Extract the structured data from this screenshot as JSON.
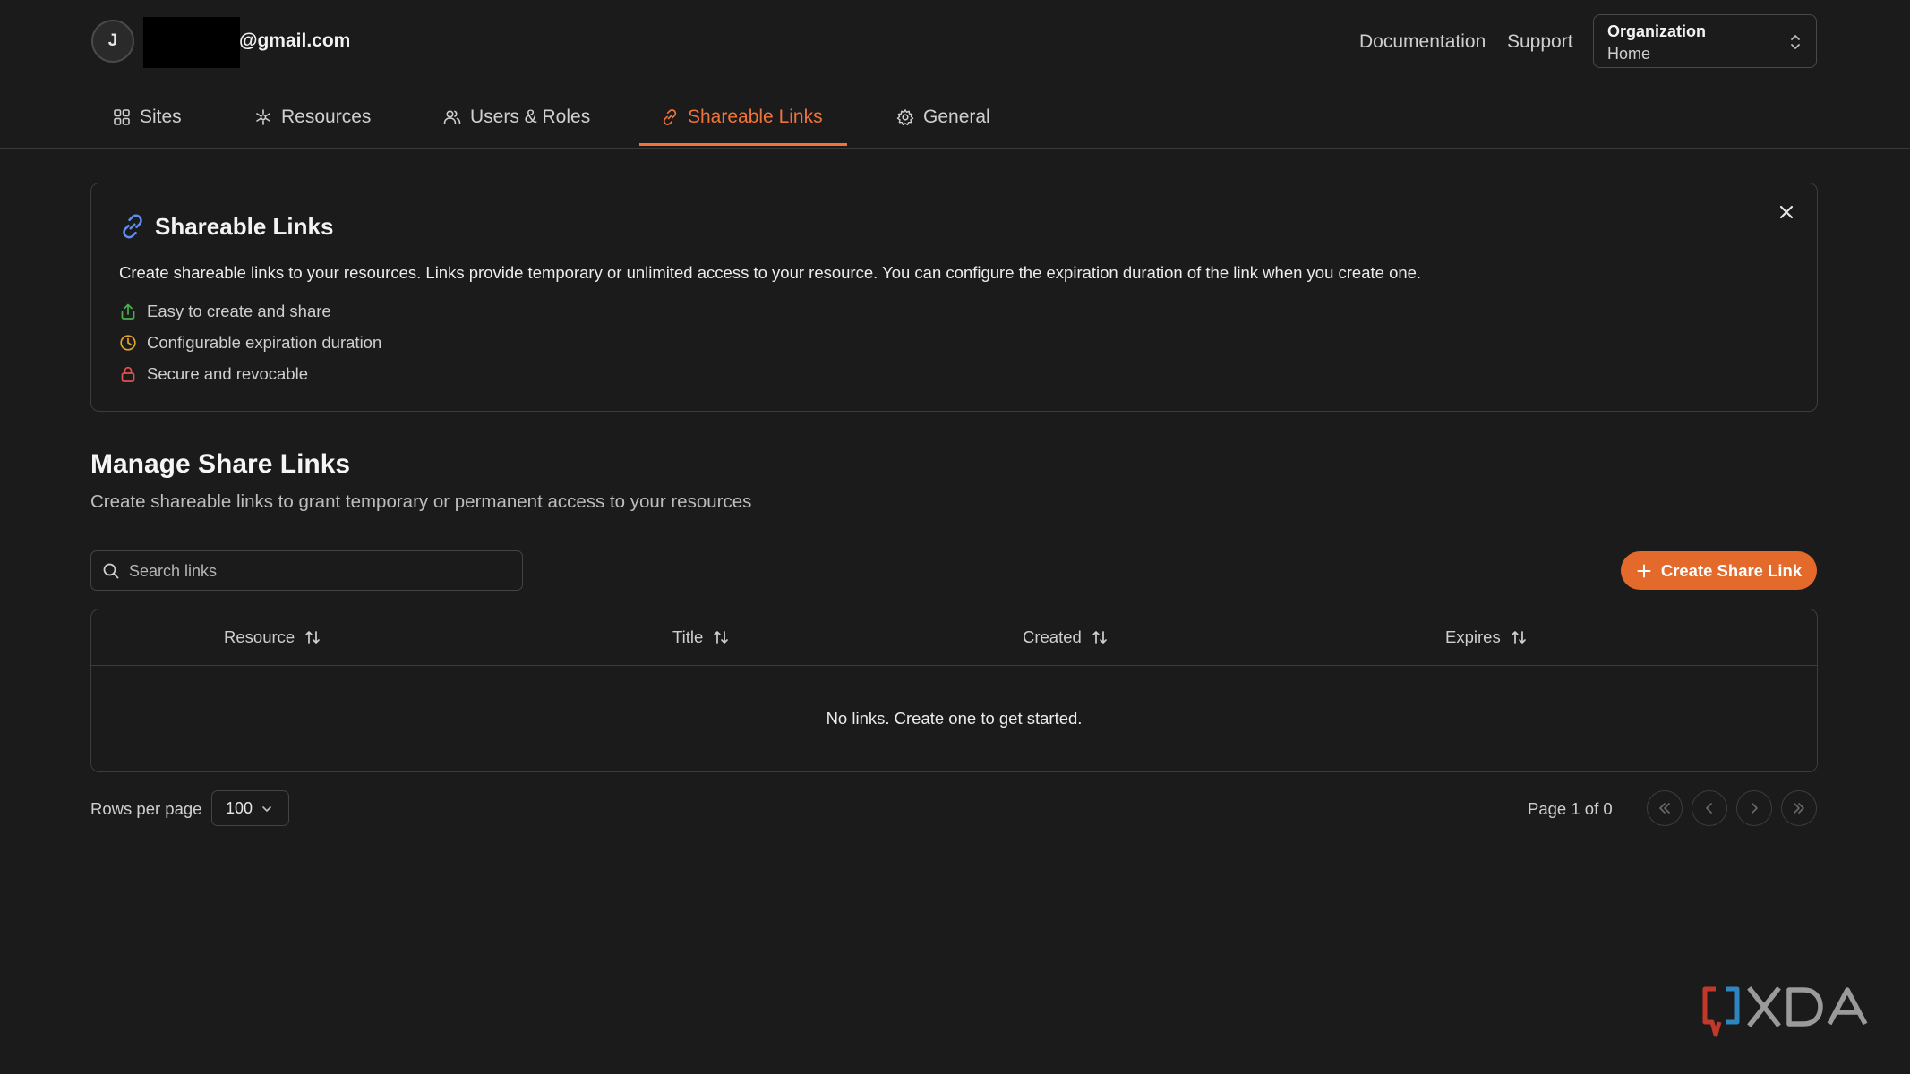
{
  "header": {
    "avatar_initial": "J",
    "email": "@gmail.com",
    "links": [
      "Documentation",
      "Support"
    ],
    "org_selector": {
      "label": "Organization",
      "value": "Home"
    }
  },
  "tabs": [
    {
      "label": "Sites",
      "icon": "sites-icon",
      "active": false
    },
    {
      "label": "Resources",
      "icon": "resources-icon",
      "active": false
    },
    {
      "label": "Users & Roles",
      "icon": "users-icon",
      "active": false
    },
    {
      "label": "Shareable Links",
      "icon": "link-icon",
      "active": true
    },
    {
      "label": "General",
      "icon": "gear-icon",
      "active": false
    }
  ],
  "info_card": {
    "title": "Shareable Links",
    "description": "Create shareable links to your resources. Links provide temporary or unlimited access to your resource. You can configure the expiration duration of the link when you create one.",
    "features": [
      {
        "text": "Easy to create and share",
        "icon": "share-icon",
        "color": "#4caf50"
      },
      {
        "text": "Configurable expiration duration",
        "icon": "clock-icon",
        "color": "#e0a526"
      },
      {
        "text": "Secure and revocable",
        "icon": "lock-icon",
        "color": "#e35050"
      }
    ]
  },
  "section": {
    "title": "Manage Share Links",
    "subtitle": "Create shareable links to grant temporary or permanent access to your resources"
  },
  "search": {
    "placeholder": "Search links",
    "value": ""
  },
  "create_button": {
    "label": "Create Share Link",
    "icon": "plus-icon"
  },
  "table": {
    "columns": [
      "Resource",
      "Title",
      "Created",
      "Expires"
    ],
    "empty_message": "No links. Create one to get started."
  },
  "pagination": {
    "rows_per_page_label": "Rows per page",
    "rows_per_page": "100",
    "page_info": "Page 1 of 0"
  },
  "colors": {
    "accent": "#f0733a",
    "button": "#e36a2b",
    "background": "#1b1b1b",
    "link_icon": "#5b8def"
  },
  "watermark": "XDA"
}
